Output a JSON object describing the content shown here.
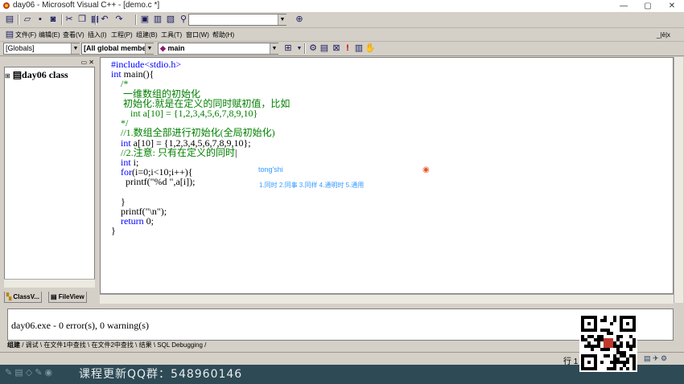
{
  "window": {
    "title": "day06 - Microsoft Visual C++ - [demo.c *]",
    "controls": [
      "—",
      "▢",
      "✕"
    ]
  },
  "toolbar1": {
    "find_value": ""
  },
  "menu": {
    "items": [
      "文件(F)",
      "编辑(E)",
      "查看(V)",
      "插入(I)",
      "工程(P)",
      "组建(B)",
      "工具(T)",
      "窗口(W)",
      "帮助(H)"
    ],
    "doc_controls": "_|ē|x"
  },
  "toolbar2": {
    "scope": "[Globals]",
    "members": "[All global members",
    "function": "main"
  },
  "workspace": {
    "class_root": "day06 class",
    "tabs": [
      "ClassV...",
      "FileView"
    ]
  },
  "editor": {
    "lines": [
      {
        "cls": "pp",
        "text": "#include<stdio.h>"
      },
      {
        "cls": "kw",
        "text": "int",
        "rest": " main(){"
      },
      {
        "cls": "cm",
        "text": "    /*"
      },
      {
        "cls": "cm",
        "text": "     一维数组的初始化"
      },
      {
        "cls": "cm",
        "text": "     初始化:就是在定义的同时赋初值，比如"
      },
      {
        "cls": "cm",
        "text": "        int a[10] = {1,2,3,4,5,6,7,8,9,10}"
      },
      {
        "cls": "cm",
        "text": "    */"
      },
      {
        "cls": "cm",
        "text": "    //1.数组全部进行初始化(全局初始化)"
      },
      {
        "cls": "kw",
        "text": "    int",
        "rest": " a[10] = {1,2,3,4,5,6,7,8,9,10};"
      },
      {
        "cls": "cm",
        "text": "    //2.注意: 只有在定义的同时"
      },
      {
        "cls": "kw",
        "text": "    int",
        "rest": " i;"
      },
      {
        "cls": "kw",
        "text": "    for",
        "rest": "(i=0;i<10;i++){"
      },
      {
        "cls": "",
        "text": "      printf(\"%d \",a[i]);"
      },
      {
        "cls": "",
        "text": ""
      },
      {
        "cls": "",
        "text": "    }"
      },
      {
        "cls": "",
        "text": "    printf(\"\\n\");"
      },
      {
        "cls": "kw",
        "text": "    return",
        "rest": " 0;"
      },
      {
        "cls": "",
        "text": "}"
      }
    ],
    "ime_pinyin": "tong'shi",
    "ime_candidates": "1.同时  2.同事  3.同样  4.通明时  5.通用"
  },
  "output": {
    "text": "day06.exe - 0 error(s), 0 warning(s)",
    "tabs": [
      "组建",
      "调试",
      "在文件1中查找",
      "在文件2中查找",
      "结果",
      "SQL Debugging"
    ]
  },
  "status": {
    "line_label": "行 1"
  },
  "banner": {
    "text": "课程更新QQ群：548960146"
  }
}
